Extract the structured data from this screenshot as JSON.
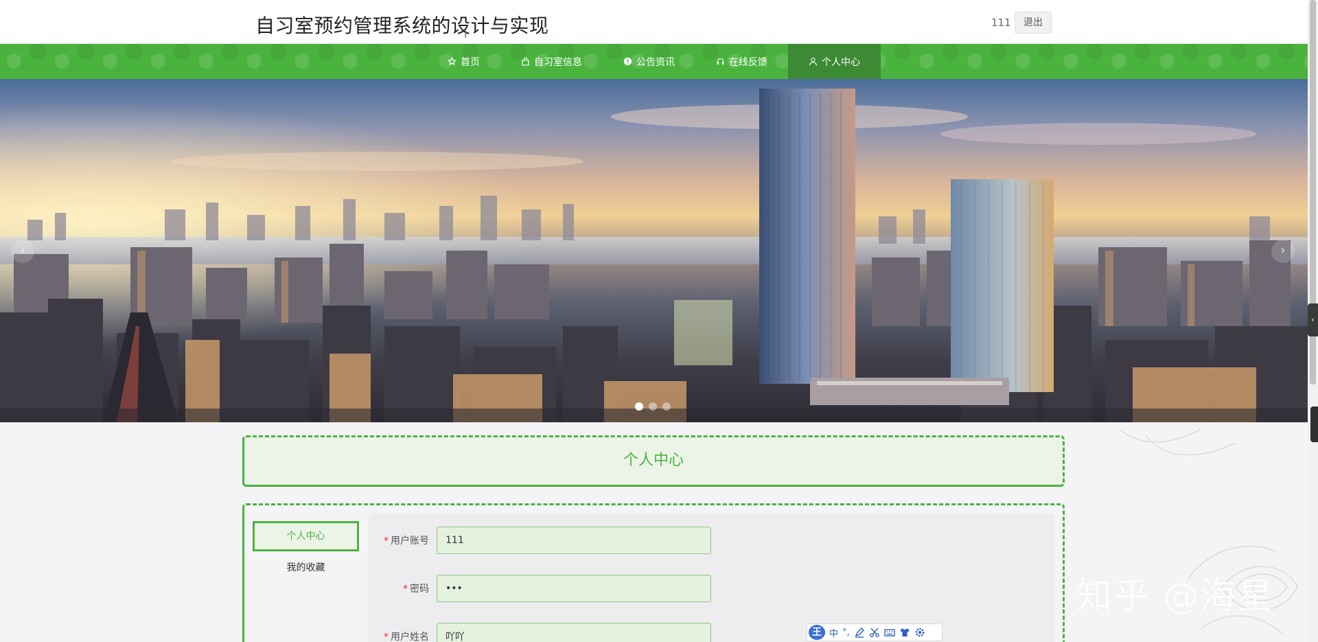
{
  "header": {
    "site_title": "自习室预约管理系统的设计与实现",
    "username": "111",
    "logout_label": "退出"
  },
  "nav": {
    "items": [
      {
        "label": "首页",
        "icon": "star-icon"
      },
      {
        "label": "自习室信息",
        "icon": "bag-icon"
      },
      {
        "label": "公告资讯",
        "icon": "info-icon"
      },
      {
        "label": "在线反馈",
        "icon": "headset-icon"
      },
      {
        "label": "个人中心",
        "icon": "user-icon",
        "active": true
      }
    ]
  },
  "banner": {
    "prev_label": "‹",
    "next_label": "›",
    "slides": 3,
    "active_slide": 1
  },
  "page": {
    "title": "个人中心"
  },
  "sidebar": {
    "items": [
      {
        "label": "个人中心",
        "active": true
      },
      {
        "label": "我的收藏",
        "active": false
      }
    ]
  },
  "form": {
    "fields": [
      {
        "label": "用户账号",
        "value": "111",
        "required": true,
        "type": "text"
      },
      {
        "label": "密码",
        "value": "111",
        "required": true,
        "type": "password"
      },
      {
        "label": "用户姓名",
        "value": "吖吖",
        "required": true,
        "type": "text"
      }
    ]
  },
  "watermark": "知乎 @海星",
  "ime": {
    "logo": "王",
    "mode": "中",
    "punct": "°,"
  },
  "colors": {
    "primary": "#4ab33e",
    "nav_active": "#3d8a35",
    "required": "#e2312f"
  }
}
